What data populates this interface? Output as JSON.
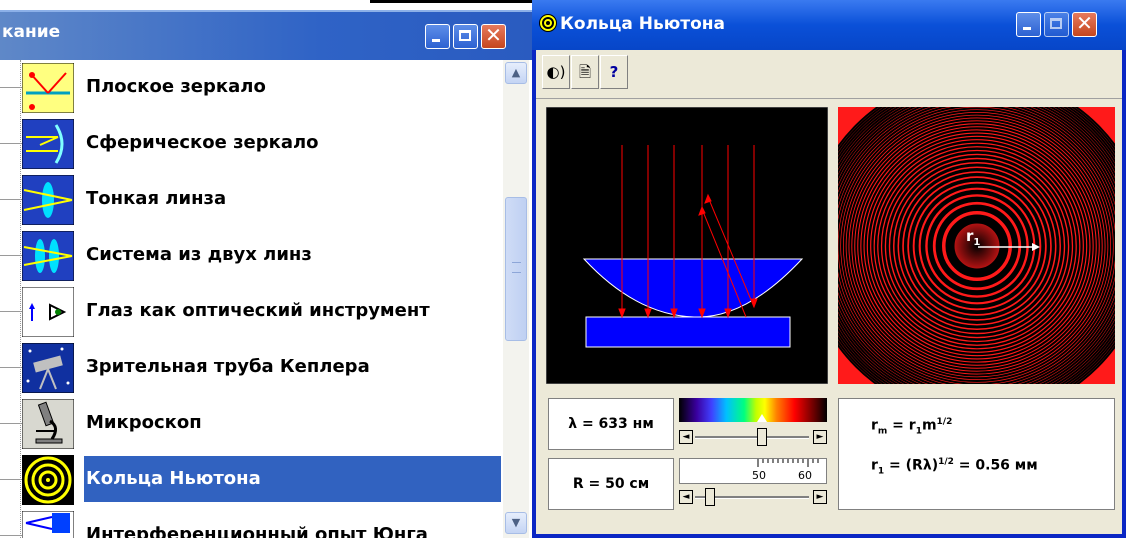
{
  "left_window": {
    "title": "кание",
    "items": [
      {
        "label": "Плоское зеркало",
        "icon": "flat-mirror-icon"
      },
      {
        "label": "Сферическое зеркало",
        "icon": "spherical-mirror-icon"
      },
      {
        "label": "Тонкая линза",
        "icon": "thin-lens-icon"
      },
      {
        "label": "Система из двух линз",
        "icon": "two-lens-icon"
      },
      {
        "label": "Глаз как оптический инструмент",
        "icon": "eye-icon"
      },
      {
        "label": "Зрительная труба Кеплера",
        "icon": "telescope-icon"
      },
      {
        "label": "Микроскоп",
        "icon": "microscope-icon"
      },
      {
        "label": "Кольца Ньютона",
        "icon": "newton-rings-icon",
        "selected": true
      },
      {
        "label": "Интерференционный опыт Юнга",
        "icon": "young-experiment-icon"
      }
    ]
  },
  "right_window": {
    "title": "Кольца Ньютона",
    "toolbar": {
      "sound": "◐)",
      "doc": "🗎",
      "help": "?"
    },
    "wavelength_label": "λ = 633 нм",
    "radius_label": "R = 50 см",
    "radius_scale": {
      "tick_50": "50",
      "tick_60": "60"
    },
    "formula_rm": {
      "r": "r",
      "m_sub": "m",
      "eq": " = r",
      "one_sub": "1",
      "m": "m",
      "sup": "1/2"
    },
    "formula_r1": {
      "r": "r",
      "sub": "1",
      "eq": " = (Rλ)",
      "sup": "1/2",
      "tail": " = 0.56 мм"
    },
    "rings_label": {
      "r": "r",
      "sub": "1"
    },
    "wavelength_slider_value": 0.6,
    "radius_slider_value": 0.1
  },
  "colors": {
    "accent": "#3162c0",
    "ring_red": "#ff1a1a",
    "glass": "#0000ff"
  }
}
